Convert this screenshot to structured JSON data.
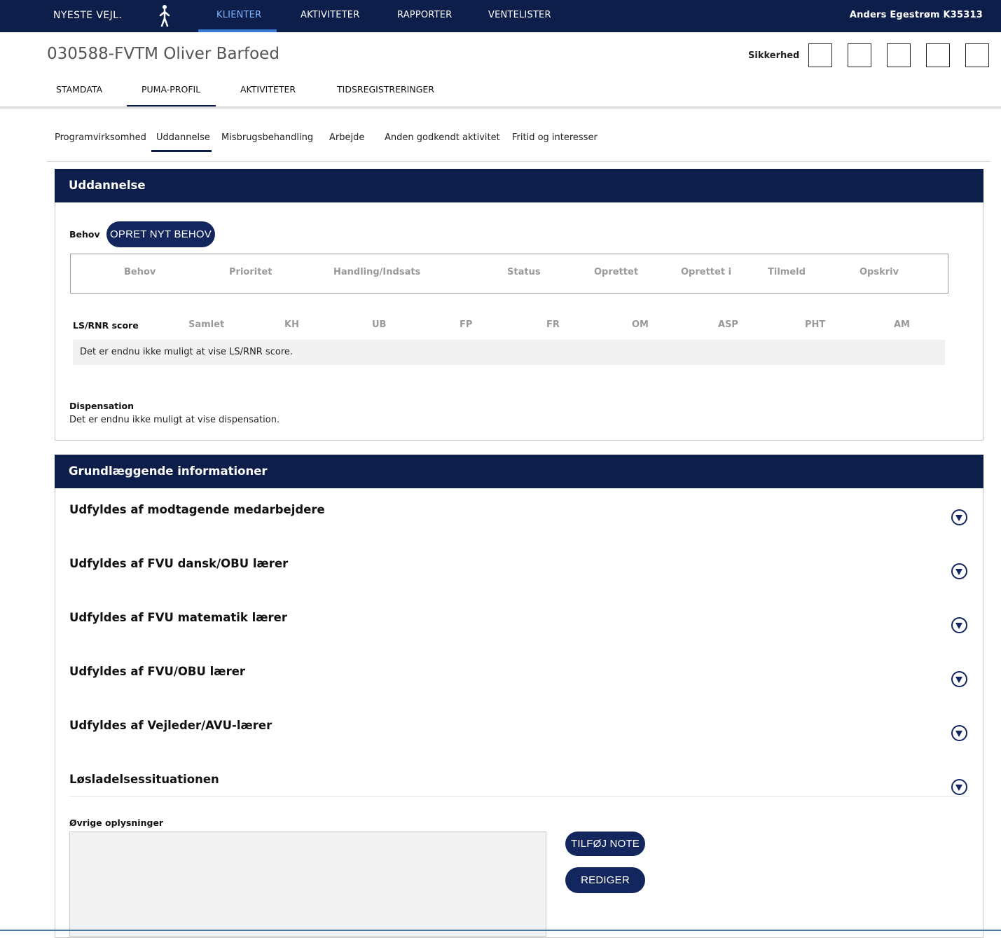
{
  "topnav": {
    "brand": "NYESTE VEJL.",
    "tabs": [
      {
        "label": "KLIENTER",
        "active": true
      },
      {
        "label": "AKTIVITETER"
      },
      {
        "label": "RAPPORTER"
      },
      {
        "label": "VENTELISTER"
      }
    ],
    "user": "Anders Egestrøm K35313"
  },
  "client": {
    "title": "030588-FVTM Oliver Barfoed",
    "security_label": "Sikkerhed",
    "tabs": [
      "STAMDATA",
      "PUMA-PROFIL",
      "AKTIVITETER",
      "TIDSREGISTRERINGER"
    ],
    "active_tab": "PUMA-PROFIL"
  },
  "program_tabs": {
    "items": [
      "Programvirksomhed",
      "Uddannelse",
      "Misbrugsbehandling",
      "Arbejde",
      "Anden godkendt aktivitet",
      "Fritid og interesser"
    ],
    "active": "Uddannelse"
  },
  "uddannelse": {
    "header": "Uddannelse",
    "behov_label": "Behov",
    "create_button": "OPRET NYT BEHOV",
    "behov_columns": [
      "Behov",
      "Prioritet",
      "Handling/Indsats",
      "Status",
      "Oprettet",
      "Oprettet i",
      "Tilmeld",
      "Opskriv"
    ],
    "score_label": "LS/RNR score",
    "score_columns": [
      "Samlet",
      "KH",
      "UB",
      "FP",
      "FR",
      "OM",
      "ASP",
      "PHT",
      "AM"
    ],
    "score_empty": "Det er endnu ikke muligt at vise LS/RNR score.",
    "dispensation_label": "Dispensation",
    "dispensation_empty": "Det er endnu ikke muligt at vise dispensation."
  },
  "grundlaeggende": {
    "header": "Grundlæggende informationer",
    "sections": [
      "Udfyldes af modtagende medarbejdere",
      "Udfyldes af FVU dansk/OBU lærer",
      "Udfyldes af FVU matematik lærer",
      "Udfyldes af FVU/OBU lærer",
      "Udfyldes af Vejleder/AVU-lærer",
      "Løsladelsessituationen"
    ],
    "notes_label": "Øvrige oplysninger",
    "add_note_button": "TILFØJ NOTE",
    "edit_button": "REDIGER"
  },
  "icons": {
    "accordion": "chevron-down-circle-icon",
    "logo": "person-walking-icon"
  },
  "colors": {
    "navy": "#0d1e4a",
    "active_tab": "#7eb4ff",
    "button": "#13275e"
  }
}
